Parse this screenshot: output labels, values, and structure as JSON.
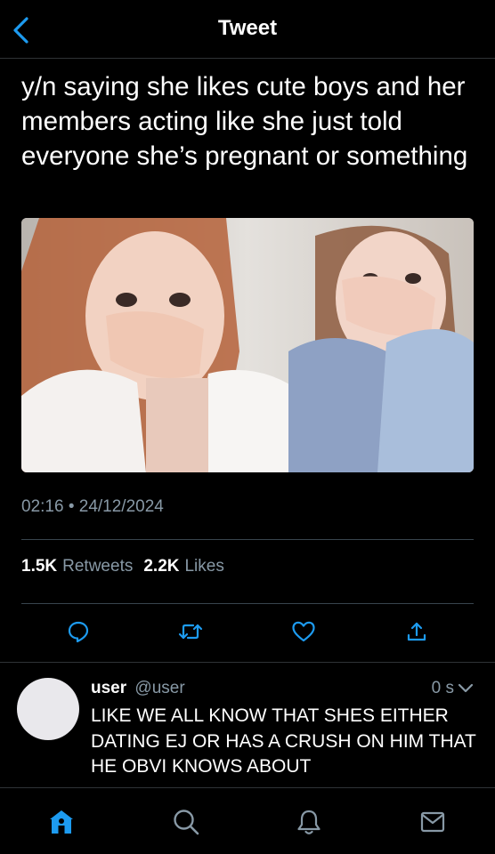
{
  "header": {
    "title": "Tweet",
    "back_icon": "chevron-left-icon"
  },
  "tweet": {
    "text": "y/n saying she likes cute boys and her members acting like she just told everyone she’s pregnant or something",
    "time": "02:16",
    "separator": "•",
    "date": "24/12/2024",
    "retweets_count": "1.5K",
    "retweets_label": "Retweets",
    "likes_count": "2.2K",
    "likes_label": "Likes"
  },
  "actions": [
    "reply-icon",
    "retweet-icon",
    "like-icon",
    "share-icon"
  ],
  "reply": {
    "name": "user",
    "handle": "@user",
    "time": "0 s",
    "text": "LIKE WE ALL KNOW THAT SHES EITHER DATING EJ OR HAS A CRUSH ON HIM THAT HE OBVI KNOWS ABOUT"
  },
  "tabbar": [
    "home-icon",
    "search-icon",
    "notifications-icon",
    "messages-icon"
  ],
  "colors": {
    "accent": "#1d9bf0",
    "muted": "#8899a6",
    "divider": "#38444d"
  }
}
